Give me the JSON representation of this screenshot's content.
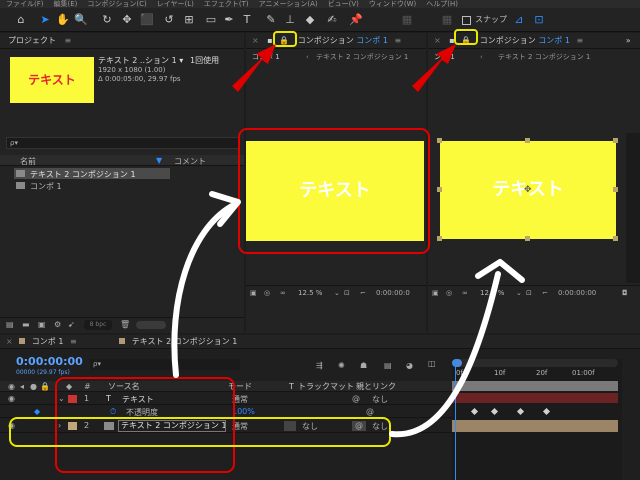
{
  "menu": [
    "ファイル(F)",
    "編集(E)",
    "コンポジション(C)",
    "レイヤー(L)",
    "エフェクト(T)",
    "アニメーション(A)",
    "ビュー(V)",
    "ウィンドウ(W)",
    "ヘルプ(H)"
  ],
  "toolbar": {
    "snap_label": "スナップ"
  },
  "project": {
    "title": "プロジェクト",
    "thumb_text": "テキスト",
    "selected_name": "テキスト 2 ..ション 1 ▾",
    "usage": "1回使用",
    "resolution": "1920 x 1080 (1.00)",
    "duration": "Δ 0:00:05:00, 29.97 fps",
    "search_placeholder": "ρ▾",
    "col_name": "名前",
    "col_comment": "コメント",
    "items": [
      "テキスト 2 コンポジション 1",
      "コンポ 1"
    ],
    "bpc": "8 bpc"
  },
  "viewer_left": {
    "tab_title": "コンポジション",
    "tab_name": "コンポ 1",
    "sub_tabs": [
      "コンポ 1",
      "テキスト 2 コンポジション 1"
    ],
    "canvas_text": "テキスト",
    "zoom": "12.5 %",
    "timecode": "0:00:00:0"
  },
  "viewer_right": {
    "tab_title": "コンポジション",
    "tab_name": "コンポ 1",
    "sub_tabs": [
      "ンポ 1",
      "テキスト 2 コンポジション 1"
    ],
    "canvas_text": "テキスト",
    "zoom": "12.5 %",
    "timecode": "0:00:00:00"
  },
  "timeline": {
    "tabs": [
      "コンポ 1",
      "テキスト 2 コンポジション 1"
    ],
    "timecode": "0:00:00:00",
    "fps": "00000 (29.97 fps)",
    "search_placeholder": "ρ▾",
    "col_source": "ソース名",
    "col_mode": "モード",
    "col_t": "T",
    "col_track": "トラックマット",
    "col_parent": "親とリンク",
    "ruler": [
      "0f",
      "10f",
      "20f",
      "01:00f"
    ],
    "layers": [
      {
        "num": "1",
        "type": "T",
        "name": "テキスト",
        "mode": "通常",
        "track": "",
        "parent": "なし",
        "color": "#cc3333"
      },
      {
        "num": "",
        "type": "",
        "name": "不透明度",
        "mode": "100%",
        "track": "",
        "parent": "",
        "color": ""
      },
      {
        "num": "2",
        "type": "",
        "name": "テキスト 2 コンポジション 1",
        "mode": "通常",
        "track": "なし",
        "parent": "なし",
        "color": "#c2a878"
      }
    ]
  },
  "colors": {
    "accent_yellow": "#fbfa3b",
    "annotation_red": "#e00000",
    "annotation_yellow": "#e8e800",
    "ae_blue": "#2b8cff"
  }
}
